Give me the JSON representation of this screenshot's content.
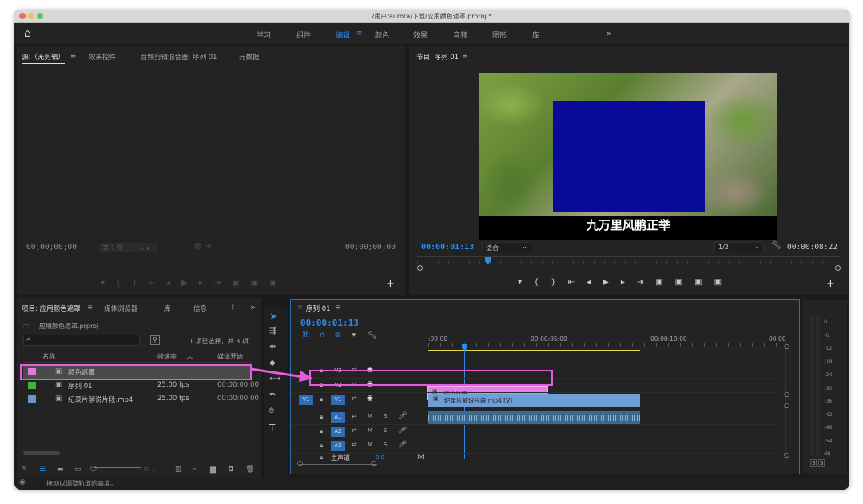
{
  "window": {
    "title": "/用户/aurora/下载/应用颜色遮罩.prproj *"
  },
  "workspaces": {
    "home": "⌂",
    "items": [
      "学习",
      "组件",
      "编辑",
      "颜色",
      "效果",
      "音频",
      "图形",
      "库"
    ],
    "active": "编辑",
    "more": "»",
    "menu": "≡"
  },
  "source": {
    "tabs": [
      "源:（无剪辑）",
      "效果控件",
      "音频剪辑混合器: 序列 01",
      "元数据"
    ],
    "menu": "≡",
    "timecode_left": "00;00;00;00",
    "timecode_right": "00;00;00;00",
    "page": "第 1 页"
  },
  "program": {
    "title": "节目: 序列 01",
    "menu": "≡",
    "timecode": "00:00:01:13",
    "fit": "适合",
    "resolution": "1/2",
    "duration": "00:00:08:22",
    "caption": "九万里风鹏正举",
    "mask_color": "#0a0a9a"
  },
  "project": {
    "tabs": [
      "项目: 应用颜色遮罩",
      "媒体浏览器",
      "库",
      "信息"
    ],
    "more": "»",
    "menu": "≡",
    "file": "应用颜色遮罩.prproj",
    "selection": "1 项已选择，共 3 项",
    "columns": [
      "名称",
      "帧速率",
      "媒体开始"
    ],
    "items": [
      {
        "name": "颜色遮罩",
        "fps": "",
        "start": "",
        "color": "#e07ad8",
        "selected": true
      },
      {
        "name": "序列 01",
        "fps": "25.00 fps",
        "start": "00:00:00:00",
        "color": "#3fb23f",
        "selected": false
      },
      {
        "name": "纪录片解说片段.mp4",
        "fps": "25.00 fps",
        "start": "00:00:00:00",
        "color": "#6a95c4",
        "selected": false
      }
    ]
  },
  "timeline": {
    "tab": "序列 01",
    "menu": "≡",
    "timecode": "00:00:01:13",
    "ruler": [
      ":00:00",
      "00:00:05:00",
      "00:00:10:00",
      "00:00"
    ],
    "video_tracks": [
      "V3",
      "V2",
      "V1"
    ],
    "audio_tracks": [
      "A1",
      "A2",
      "A3"
    ],
    "master": "主声道",
    "master_value": "0.0",
    "track_letters": {
      "m": "M",
      "s": "S"
    },
    "source_patch": "V1",
    "clips": {
      "mask": "颜色遮罩",
      "video": "纪录片解说片段.mp4 [V]"
    },
    "colors": {
      "mask_clip": "#e47ee4",
      "video_clip": "#6f9ed6",
      "audio_clip": "#3c6a8e",
      "highlight": "#e85ae0"
    }
  },
  "meter": {
    "scale": [
      "0",
      "-6",
      "-12",
      "-18",
      "-24",
      "-30",
      "-36",
      "-42",
      "-48",
      "-54",
      "dB"
    ],
    "solo": [
      "S",
      "S"
    ]
  },
  "status": {
    "text": "拖动以调整轨道的高度。"
  }
}
